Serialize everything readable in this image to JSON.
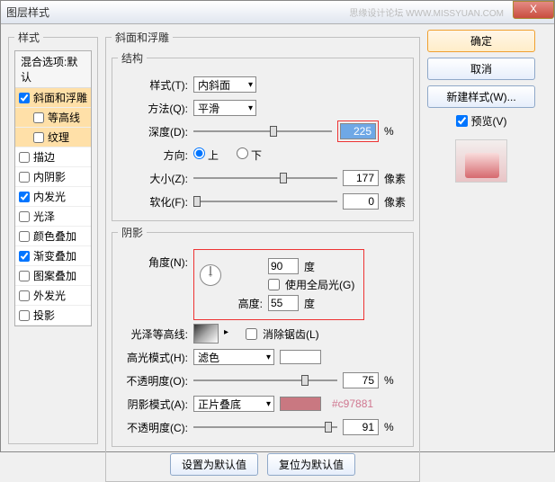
{
  "window": {
    "title": "图层样式",
    "watermark": "思缘设计论坛  WWW.MISSYUAN.COM",
    "close": "X"
  },
  "left_panel": {
    "legend": "样式",
    "header": "混合选项:默认",
    "items": [
      {
        "label": "斜面和浮雕",
        "checked": true,
        "selected": true
      },
      {
        "label": "等高线",
        "checked": false,
        "sub": true,
        "selected": true
      },
      {
        "label": "纹理",
        "checked": false,
        "sub": true,
        "selected": true
      },
      {
        "label": "描边",
        "checked": false
      },
      {
        "label": "内阴影",
        "checked": false
      },
      {
        "label": "内发光",
        "checked": true
      },
      {
        "label": "光泽",
        "checked": false
      },
      {
        "label": "颜色叠加",
        "checked": false
      },
      {
        "label": "渐变叠加",
        "checked": true
      },
      {
        "label": "图案叠加",
        "checked": false
      },
      {
        "label": "外发光",
        "checked": false
      },
      {
        "label": "投影",
        "checked": false
      }
    ]
  },
  "bevel": {
    "legend": "斜面和浮雕",
    "struct_legend": "结构",
    "style_label": "样式(T):",
    "style_val": "内斜面",
    "tech_label": "方法(Q):",
    "tech_val": "平滑",
    "depth_label": "深度(D):",
    "depth_val": "225",
    "depth_unit": "%",
    "dir_label": "方向:",
    "dir_up": "上",
    "dir_down": "下",
    "size_label": "大小(Z):",
    "size_val": "177",
    "size_unit": "像素",
    "soften_label": "软化(F):",
    "soften_val": "0",
    "soften_unit": "像素",
    "shadow_legend": "阴影",
    "angle_label": "角度(N):",
    "angle_val": "90",
    "angle_unit": "度",
    "global_label": "使用全局光(G)",
    "alt_label": "高度:",
    "alt_val": "55",
    "alt_unit": "度",
    "gloss_label": "光泽等高线:",
    "antialias_label": "消除锯齿(L)",
    "hl_mode_label": "高光模式(H):",
    "hl_mode_val": "滤色",
    "hl_color": "#ffffff",
    "hl_opac_label": "不透明度(O):",
    "hl_opac_val": "75",
    "hl_opac_unit": "%",
    "sh_mode_label": "阴影模式(A):",
    "sh_mode_val": "正片叠底",
    "sh_color": "#c97881",
    "sh_color_label": "#c97881",
    "sh_opac_label": "不透明度(C):",
    "sh_opac_val": "91",
    "sh_opac_unit": "%",
    "btn_default": "设置为默认值",
    "btn_reset": "复位为默认值"
  },
  "right": {
    "ok": "确定",
    "cancel": "取消",
    "new_style": "新建样式(W)...",
    "preview_label": "预览(V)"
  }
}
